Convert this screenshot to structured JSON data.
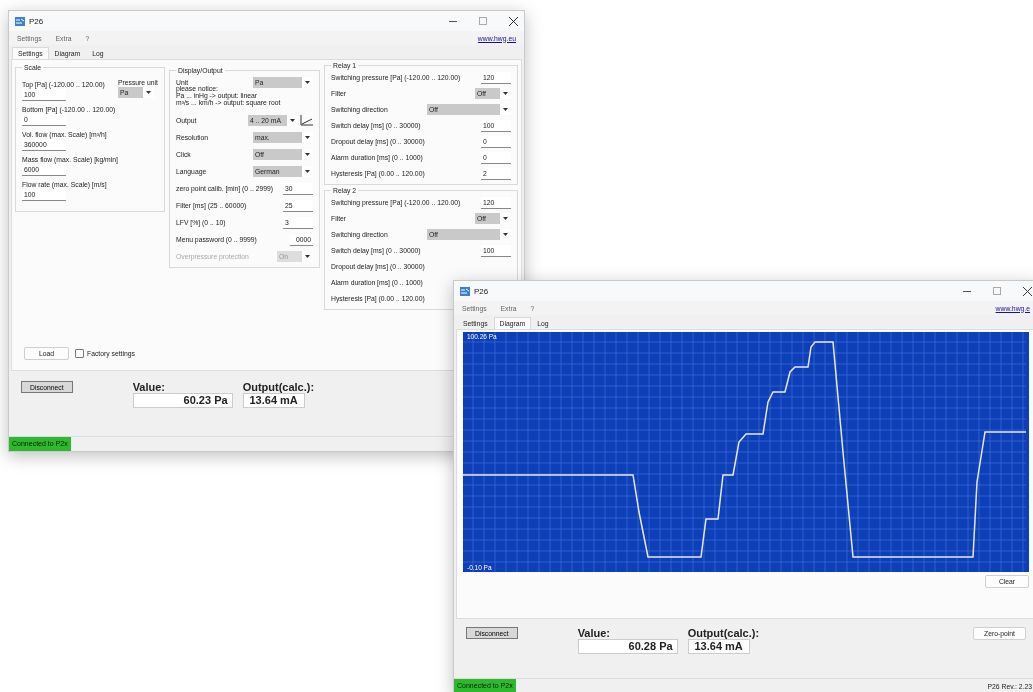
{
  "settings_window": {
    "title": "P26",
    "menu": [
      "Settings",
      "Extra",
      "?"
    ],
    "link": "www.hwg.eu",
    "tabs": [
      {
        "label": "Settings",
        "selected": true
      },
      {
        "label": "Diagram",
        "selected": false
      },
      {
        "label": "Log",
        "selected": false
      }
    ],
    "scale": {
      "title": "Scale",
      "fields": [
        {
          "label": "Top [Pa] (-120.00 .. 120.00)",
          "value": "100"
        },
        {
          "label": "Bottom [Pa] (-120.00 .. 120.00)",
          "value": "0"
        },
        {
          "label": "Vol. flow (max. Scale) [m³/h]",
          "value": "360000"
        },
        {
          "label": "Mass flow (max. Scale) [kg/min]",
          "value": "6000"
        },
        {
          "label": "Flow rate (max. Scale) [m/s]",
          "value": "100"
        }
      ],
      "pressure_unit": {
        "label": "Pressure unit",
        "value": "Pa"
      }
    },
    "display_output": {
      "title": "Display/Output",
      "rows": [
        {
          "kind": "select",
          "label": "Unit",
          "value": "Pa"
        },
        {
          "kind": "note",
          "lines": [
            "please notice:",
            "Pa ... inHg -> output: linear",
            "m³/s ... km/h -> output: square root"
          ]
        },
        {
          "kind": "outputselect",
          "label": "Output",
          "value": "4 .. 20 mA"
        },
        {
          "kind": "select",
          "label": "Resolution",
          "value": "max."
        },
        {
          "kind": "select",
          "label": "Click",
          "value": "Off"
        },
        {
          "kind": "select",
          "label": "Language",
          "value": "German"
        },
        {
          "kind": "input",
          "label": "zero point calib. [min] (0 .. 2999)",
          "value": "30"
        },
        {
          "kind": "input",
          "label": "Filter [ms] (25 .. 60000)",
          "value": "25"
        },
        {
          "kind": "input",
          "label": "LFV [%] (0 .. 10)",
          "value": "3"
        },
        {
          "kind": "shortinput",
          "label": "Menu password (0 .. 9999)",
          "value": "0000"
        },
        {
          "kind": "smallselect",
          "label": "Overpressure protection",
          "value": "On",
          "disabled": true
        }
      ]
    },
    "relays": [
      {
        "title": "Relay 1",
        "rows": [
          {
            "kind": "input",
            "label": "Switching pressure [Pa] (-120.00 .. 120.00)",
            "value": "120"
          },
          {
            "kind": "smallselect",
            "label": "Filter",
            "value": "Off"
          },
          {
            "kind": "wideselect",
            "label": "Switching direction",
            "value": "Off"
          },
          {
            "kind": "input",
            "label": "Switch delay [ms] (0 .. 30000)",
            "value": "100"
          },
          {
            "kind": "input",
            "label": "Dropout delay [ms] (0 .. 30000)",
            "value": "0"
          },
          {
            "kind": "input",
            "label": "Alarm duration [ms] (0 .. 1000)",
            "value": "0"
          },
          {
            "kind": "input",
            "label": "Hysteresis [Pa] (0.00 .. 120.00)",
            "value": "2"
          }
        ]
      },
      {
        "title": "Relay 2",
        "rows": [
          {
            "kind": "input",
            "label": "Switching pressure [Pa] (-120.00 .. 120.00)",
            "value": "120"
          },
          {
            "kind": "smallselect",
            "label": "Filter",
            "value": "Off"
          },
          {
            "kind": "wideselect",
            "label": "Switching direction",
            "value": "Off"
          },
          {
            "kind": "input",
            "label": "Switch delay [ms] (0 .. 30000)",
            "value": "100"
          },
          {
            "kind": "input",
            "label": "Dropout delay [ms] (0 .. 30000)"
          },
          {
            "kind": "input",
            "label": "Alarm duration [ms] (0 .. 1000)"
          },
          {
            "kind": "input",
            "label": "Hysteresis [Pa] (0.00 .. 120.00)"
          }
        ]
      }
    ],
    "load_button": "Load",
    "factory_settings": {
      "label": "Factory settings",
      "checked": false
    },
    "disconnect_button": "Disconnect",
    "value": {
      "label": "Value:",
      "reading": "60.23 Pa"
    },
    "output": {
      "label": "Output(calc.):",
      "reading": "13.64 mA"
    },
    "status": "Connected to P2x"
  },
  "diagram_window": {
    "title": "P26",
    "menu": [
      "Settings",
      "Extra",
      "?"
    ],
    "link": "www.hwg.e",
    "tabs": [
      {
        "label": "Settings",
        "selected": false
      },
      {
        "label": "Diagram",
        "selected": true
      },
      {
        "label": "Log",
        "selected": false
      }
    ],
    "chart": {
      "top_label": "100.26 Pa",
      "bottom_label": "-0.10 Pa"
    },
    "clear_button": "Clear",
    "disconnect_button": "Disconnect",
    "value": {
      "label": "Value:",
      "reading": "60.28 Pa"
    },
    "output": {
      "label": "Output(calc.):",
      "reading": "13.64 mA"
    },
    "zero_point_button": "Zero-point",
    "status": "Connected to P2x",
    "revision": "P26 Rev.: 2.23"
  }
}
